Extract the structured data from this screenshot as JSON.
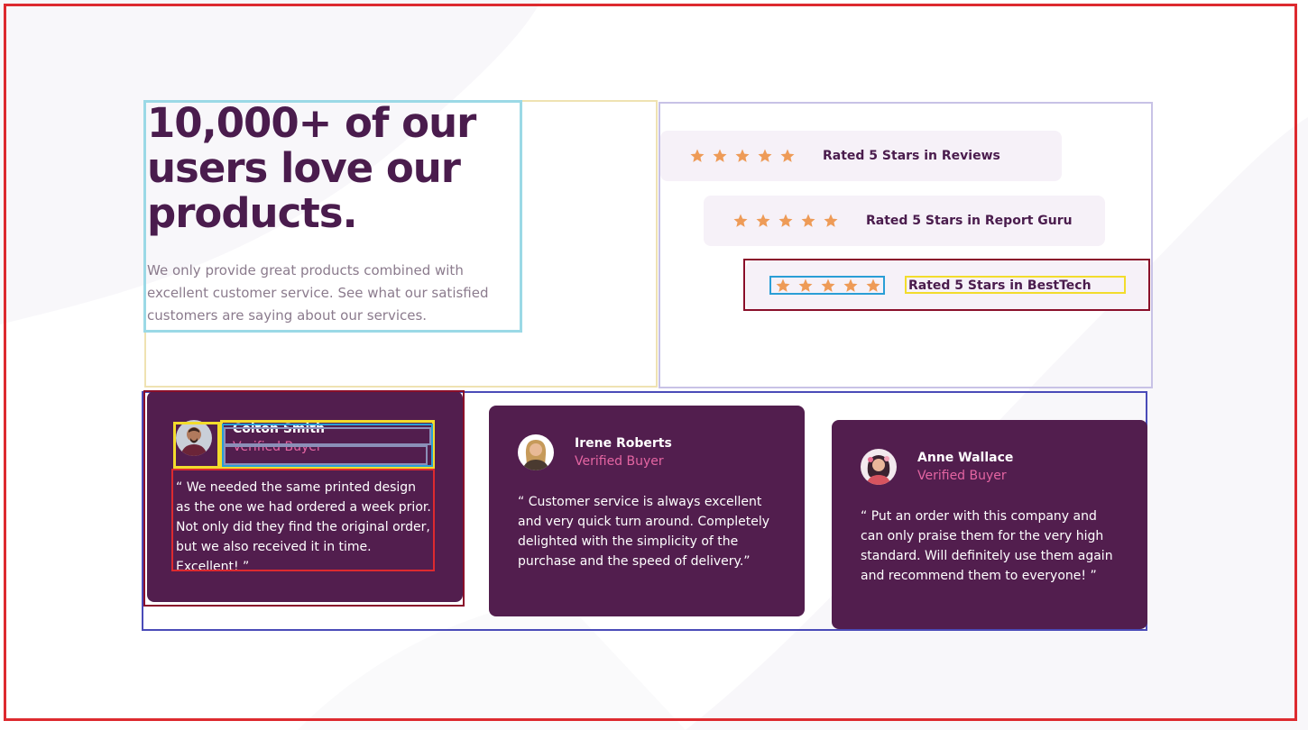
{
  "hero": {
    "heading": "10,000+ of our users love our products.",
    "text": "We only provide great products combined with excellent customer service. See what our satisfied customers are saying about our services."
  },
  "ratings": [
    {
      "label": "Rated 5 Stars in Reviews",
      "stars": 5
    },
    {
      "label": "Rated 5 Stars in Report Guru",
      "stars": 5
    },
    {
      "label": "Rated 5 Stars in BestTech",
      "stars": 5
    }
  ],
  "testimonials": [
    {
      "name": "Colton Smith",
      "role": "Verified Buyer",
      "quote": "“ We needed the same printed design as the one we had ordered a week prior. Not only did they find the original order, but we also received it in time. Excellent! ”"
    },
    {
      "name": "Irene Roberts",
      "role": "Verified Buyer",
      "quote": "“ Customer service is always excellent and very quick turn around. Completely delighted with the simplicity of the purchase and the speed of delivery.”"
    },
    {
      "name": "Anne Wallace",
      "role": "Verified Buyer",
      "quote": "“ Put an order with this company and can only praise them for the very high standard. Will definitely use them again and recommend them to everyone! ”"
    }
  ],
  "colors": {
    "heading": "#4a1c4d",
    "card_bg": "#521e4e",
    "star": "#ee9b57",
    "pill_bg": "#f6f1f8",
    "role": "#e465a2"
  }
}
